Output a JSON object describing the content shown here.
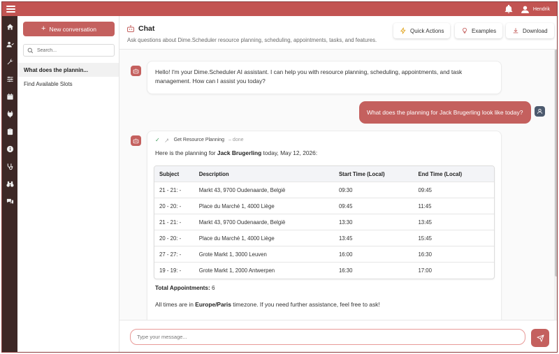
{
  "topbar": {
    "user_name": "Hendrik",
    "menu_icon": "hamburger-icon",
    "bell_icon": "bell-icon",
    "user_icon": "user-icon"
  },
  "rail": {
    "icons": [
      "home-icon",
      "users-icon",
      "wrench-icon",
      "sliders-icon",
      "calendar-icon",
      "plug-icon",
      "clipboard-icon",
      "info-icon",
      "stethoscope-icon",
      "binoculars-icon",
      "chat-icon"
    ]
  },
  "sidebar": {
    "new_conversation_label": "New conversation",
    "search_placeholder": "Search...",
    "conversations": [
      {
        "label": "What does the plannin...",
        "active": true
      },
      {
        "label": "Find Available Slots",
        "active": false
      }
    ]
  },
  "header": {
    "title": "Chat",
    "subtitle": "Ask questions about Dime.Scheduler resource planning, scheduling, appointments, tasks, and features.",
    "buttons": {
      "quick_actions": "Quick Actions",
      "examples": "Examples",
      "download": "Download"
    }
  },
  "messages": {
    "assistant_greeting": "Hello! I'm your Dime.Scheduler AI assistant. I can help you with resource planning, scheduling, appointments, and task management. How can I assist you today?",
    "user_question": "What does the planning for Jack Brugerling look like today?",
    "tool": {
      "name": "Get Resource Planning",
      "status": "– done"
    },
    "intro_prefix": "Here is the planning for ",
    "intro_person": "Jack Brugerling",
    "intro_suffix": " today, May 12, 2026:",
    "table": {
      "headers": [
        "Subject",
        "Description",
        "Start Time (Local)",
        "End Time (Local)"
      ],
      "rows": [
        [
          "21 - 21: -",
          "Markt 43, 9700 Oudenaarde, België",
          "09:30",
          "09:45"
        ],
        [
          "20 - 20: -",
          "Place du Marché 1, 4000 Liège",
          "09:45",
          "11:45"
        ],
        [
          "21 - 21: -",
          "Markt 43, 9700 Oudenaarde, België",
          "13:30",
          "13:45"
        ],
        [
          "20 - 20: -",
          "Place du Marché 1, 4000 Liège",
          "13:45",
          "15:45"
        ],
        [
          "27 - 27: -",
          "Grote Markt 1, 3000 Leuven",
          "16:00",
          "16:30"
        ],
        [
          "19 - 19: -",
          "Grote Markt 1, 2000 Antwerpen",
          "16:30",
          "17:00"
        ]
      ]
    },
    "total_label": "Total Appointments:",
    "total_value": "6",
    "tz_prefix": "All times are in ",
    "tz_name": "Europe/Paris",
    "tz_suffix": " timezone. If you need further assistance, feel free to ask!"
  },
  "composer": {
    "placeholder": "Type your message..."
  },
  "colors": {
    "accent": "#c4605e",
    "topbar": "#c25452",
    "rail": "#3d2826"
  }
}
